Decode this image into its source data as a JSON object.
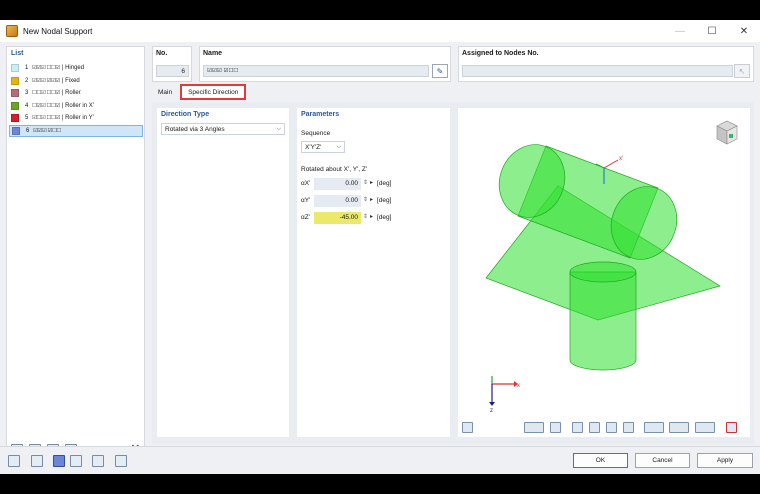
{
  "window": {
    "title": "New Nodal Support",
    "minimize": "—",
    "maximize": "☐",
    "close": "✕"
  },
  "list": {
    "header": "List",
    "items": [
      {
        "num": "1",
        "boxes": "☑☑☑ ☐☐☑",
        "label": "| Hinged",
        "color": "#c8f0f4"
      },
      {
        "num": "2",
        "boxes": "☑☑☑ ☑☑☑",
        "label": "| Fixed",
        "color": "#e7b313"
      },
      {
        "num": "3",
        "boxes": "☐☐☑ ☐☐☑",
        "label": "| Roller",
        "color": "#b56d7e"
      },
      {
        "num": "4",
        "boxes": "☐☑☑ ☐☐☑",
        "label": "| Roller in X'",
        "color": "#6aa52a"
      },
      {
        "num": "5",
        "boxes": "☑☐☑ ☐☐☑",
        "label": "| Roller in Y'",
        "color": "#d81e2a"
      },
      {
        "num": "6",
        "boxes": "☑☑☑ ☑☐☐",
        "label": "",
        "color": "#6b86d6"
      }
    ],
    "delete_icon": "✕"
  },
  "number": {
    "label": "No.",
    "value": "6"
  },
  "name": {
    "label": "Name",
    "value": "☑☑☑ ☑☐☐",
    "edit_icon": "✎"
  },
  "assigned": {
    "label": "Assigned to Nodes No.",
    "value": "",
    "pick_icon": "↖"
  },
  "tabs": [
    {
      "label": "Main"
    },
    {
      "label": "Specific Direction"
    }
  ],
  "direction": {
    "header": "Direction Type",
    "selected": "Rotated via 3 Angles",
    "caret": "⌵"
  },
  "parameters": {
    "header": "Parameters",
    "sequence_label": "Sequence",
    "sequence_value": "X'Y'Z'",
    "caret": "⌵",
    "rotated_label": "Rotated about X', Y', Z'",
    "angles": [
      {
        "symbol": "αX'",
        "value": "0.00",
        "unit": "[deg]",
        "highlight": false
      },
      {
        "symbol": "αY'",
        "value": "0.00",
        "unit": "[deg]",
        "highlight": false
      },
      {
        "symbol": "αZ'",
        "value": "-45.00",
        "unit": "[deg]",
        "highlight": true
      }
    ],
    "spin": "⇕",
    "arrow": "▸"
  },
  "viewport": {
    "axis_x": "x",
    "axis_z": "z",
    "local_x": "x'",
    "shape_color": "#2fe02f"
  },
  "buttons": {
    "ok": "OK",
    "cancel": "Cancel",
    "apply": "Apply"
  }
}
